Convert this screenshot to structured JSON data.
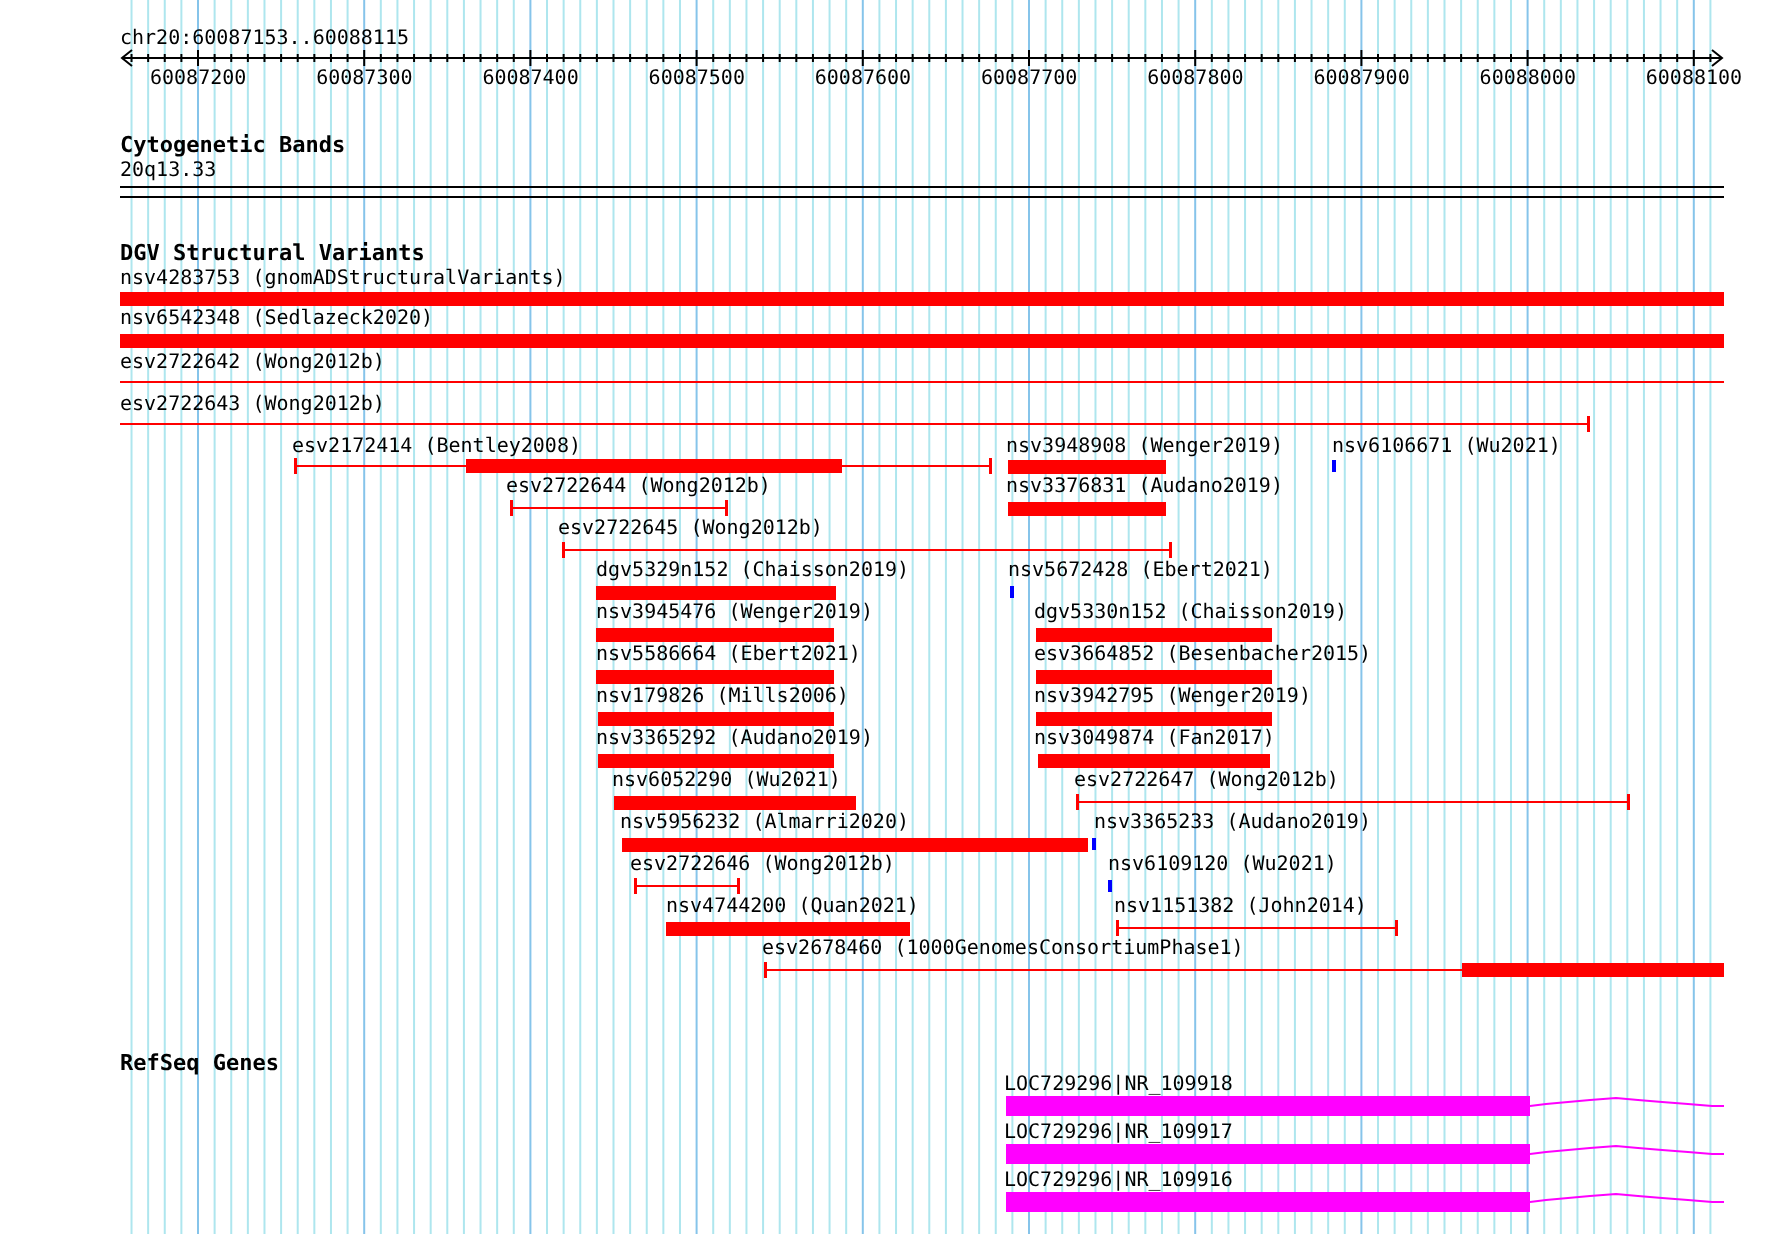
{
  "ruler": {
    "location": "chr20:60087153..60088115",
    "ticks": [
      "60087200",
      "60087300",
      "60087400",
      "60087500",
      "60087600",
      "60087700",
      "60087800",
      "60087900",
      "60088000",
      "60088100"
    ]
  },
  "cytogenetic_bands": {
    "title": "Cytogenetic Bands",
    "band": "20q13.33"
  },
  "dgv_structural_variants": {
    "title": "DGV Structural Variants",
    "features": [
      {
        "label": "nsv4283753 (gnomADStructuralVariants)",
        "kind": "bar"
      },
      {
        "label": "nsv6542348 (Sedlazeck2020)",
        "kind": "bar"
      },
      {
        "label": "esv2722642 (Wong2012b)",
        "kind": "span"
      },
      {
        "label": "esv2722643 (Wong2012b)",
        "kind": "span"
      },
      {
        "label": "esv2172414 (Bentley2008)",
        "kind": "span_bar"
      },
      {
        "label": "nsv3948908 (Wenger2019)",
        "kind": "bar"
      },
      {
        "label": "nsv6106671 (Wu2021)",
        "kind": "point"
      },
      {
        "label": "esv2722644 (Wong2012b)",
        "kind": "span"
      },
      {
        "label": "nsv3376831 (Audano2019)",
        "kind": "bar"
      },
      {
        "label": "esv2722645 (Wong2012b)",
        "kind": "span"
      },
      {
        "label": "dgv5329n152 (Chaisson2019)",
        "kind": "bar"
      },
      {
        "label": "nsv5672428 (Ebert2021)",
        "kind": "point"
      },
      {
        "label": "nsv3945476 (Wenger2019)",
        "kind": "bar"
      },
      {
        "label": "dgv5330n152 (Chaisson2019)",
        "kind": "bar"
      },
      {
        "label": "nsv5586664 (Ebert2021)",
        "kind": "bar"
      },
      {
        "label": "esv3664852 (Besenbacher2015)",
        "kind": "bar"
      },
      {
        "label": "nsv179826 (Mills2006)",
        "kind": "bar"
      },
      {
        "label": "nsv3942795 (Wenger2019)",
        "kind": "bar"
      },
      {
        "label": "nsv3365292 (Audano2019)",
        "kind": "bar"
      },
      {
        "label": "nsv3049874 (Fan2017)",
        "kind": "bar"
      },
      {
        "label": "nsv6052290 (Wu2021)",
        "kind": "bar"
      },
      {
        "label": "esv2722647 (Wong2012b)",
        "kind": "span"
      },
      {
        "label": "nsv5956232 (Almarri2020)",
        "kind": "bar"
      },
      {
        "label": "nsv3365233 (Audano2019)",
        "kind": "point"
      },
      {
        "label": "esv2722646 (Wong2012b)",
        "kind": "span"
      },
      {
        "label": "nsv6109120 (Wu2021)",
        "kind": "point"
      },
      {
        "label": "nsv4744200 (Quan2021)",
        "kind": "bar"
      },
      {
        "label": "nsv1151382 (John2014)",
        "kind": "span"
      },
      {
        "label": "esv2678460 (1000GenomesConsortiumPhase1)",
        "kind": "span_bar"
      }
    ]
  },
  "refseq_genes": {
    "title": "RefSeq Genes",
    "genes": [
      {
        "label": "LOC729296|NR_109918"
      },
      {
        "label": "LOC729296|NR_109917"
      },
      {
        "label": "LOC729296|NR_109916"
      }
    ]
  }
}
